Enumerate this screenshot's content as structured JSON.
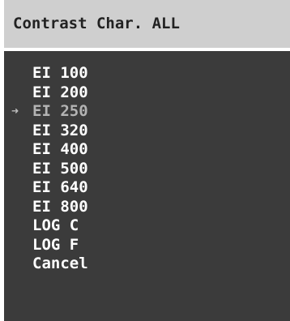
{
  "menu": {
    "title": "Contrast Char. ALL",
    "selection_marker_icon": "right-arrow-icon",
    "selected_index": 2,
    "items": [
      {
        "label": "EI 100"
      },
      {
        "label": "EI 200"
      },
      {
        "label": "EI 250"
      },
      {
        "label": "EI 320"
      },
      {
        "label": "EI 400"
      },
      {
        "label": "EI 500"
      },
      {
        "label": "EI 640"
      },
      {
        "label": "EI 800"
      },
      {
        "label": "LOG C"
      },
      {
        "label": "LOG F"
      },
      {
        "label": "Cancel"
      }
    ]
  },
  "colors": {
    "background": "#3b3b3b",
    "header": "#cfcfcf",
    "item_text": "#ffffff",
    "selected_text": "#b4b4b4"
  }
}
